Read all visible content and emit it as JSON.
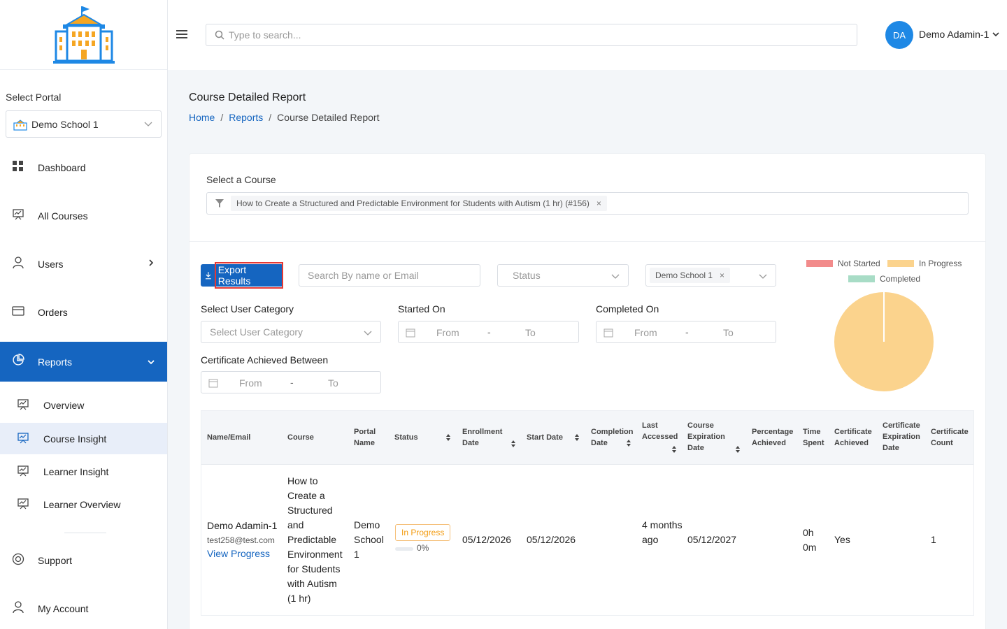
{
  "sidebar": {
    "portal_label": "Select Portal",
    "portal_value": "Demo School 1",
    "items": [
      {
        "label": "Dashboard"
      },
      {
        "label": "All Courses"
      },
      {
        "label": "Users"
      },
      {
        "label": "Orders"
      },
      {
        "label": "Reports"
      }
    ],
    "sub_items": [
      {
        "label": "Overview"
      },
      {
        "label": "Course Insight"
      },
      {
        "label": "Learner Insight"
      },
      {
        "label": "Learner Overview"
      }
    ],
    "bottom_items": [
      {
        "label": "Support"
      },
      {
        "label": "My Account"
      }
    ]
  },
  "header": {
    "search_placeholder": "Type to search...",
    "avatar_initials": "DA",
    "user_name": "Demo Adamin-1"
  },
  "page": {
    "title": "Course Detailed Report",
    "breadcrumb": [
      "Home",
      "Reports",
      "Course Detailed Report"
    ]
  },
  "filters": {
    "course_label": "Select a Course",
    "course_value": "How to Create a Structured and Predictable Environment for Students with Autism (1 hr) (#156)",
    "export_label": "Export Results",
    "search_placeholder": "Search By name or Email",
    "status_placeholder": "Status",
    "school_value": "Demo School 1",
    "user_category_label": "Select User Category",
    "user_category_placeholder": "Select User Category",
    "started_on_label": "Started On",
    "completed_on_label": "Completed On",
    "cert_label": "Certificate Achieved Between",
    "from": "From",
    "to": "To",
    "dash": "-"
  },
  "chart_data": {
    "type": "pie",
    "categories": [
      "Not Started",
      "In Progress",
      "Completed"
    ],
    "values": [
      0,
      1,
      0
    ],
    "legend_position": "top"
  },
  "colors": {
    "not_started": "#f28b8b",
    "in_progress": "#fbd38d",
    "completed": "#a8dcc6",
    "primary": "#1565c0"
  },
  "table": {
    "headers": [
      "Name/Email",
      "Course",
      "Portal Name",
      "Status",
      "Enrollment Date",
      "Start Date",
      "Completion Date",
      "Last Accessed",
      "Course Expiration Date",
      "Percentage Achieved",
      "Time Spent",
      "Certificate Achieved",
      "Certificate Expiration Date",
      "Certificate Count"
    ],
    "row": {
      "name": "Demo Adamin-1",
      "email": "test258@test.com",
      "view_progress": "View Progress",
      "course": "How to Create a Structured and Predictable Environment for Students with Autism (1 hr)",
      "portal": "Demo School 1",
      "status": "In Progress",
      "progress_pct": "0%",
      "progress": 0,
      "enrollment_date": "05/12/2026",
      "start_date": "05/12/2026",
      "completion_date": "",
      "last_accessed": "4 months ago",
      "course_expiration": "05/12/2027",
      "percentage": "",
      "time_spent": "0h 0m",
      "cert_achieved": "Yes",
      "cert_expiration": "",
      "cert_count": "1"
    }
  }
}
